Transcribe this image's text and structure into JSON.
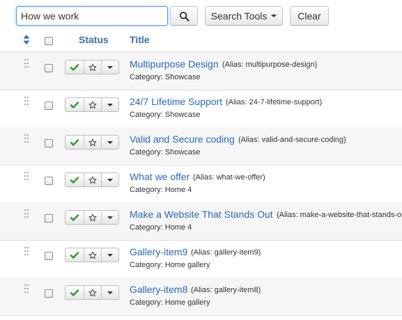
{
  "search": {
    "value": "How we work",
    "placeholder": ""
  },
  "toolbar": {
    "search_button_icon": "search-icon",
    "search_tools_label": "Search Tools",
    "clear_label": "Clear"
  },
  "table": {
    "headers": {
      "sort": "sort-icon",
      "status": "Status",
      "title": "Title"
    },
    "rows": [
      {
        "title": "Multipurpose Design",
        "alias": "(Alias: multipurpose-design)",
        "category": "Category: Showcase"
      },
      {
        "title": "24/7 Lifetime Support",
        "alias": "(Alias: 24-7-lifetime-support)",
        "category": "Category: Showcase"
      },
      {
        "title": "Valid and Secure coding",
        "alias": "(Alias: valid-and-secure-coding)",
        "category": "Category: Showcase"
      },
      {
        "title": "What we offer",
        "alias": "(Alias: what-we-offer)",
        "category": "Category: Home 4"
      },
      {
        "title": "Make a Website That Stands Out",
        "alias": "(Alias: make-a-website-that-stands-out)",
        "category": "Category: Home 4"
      },
      {
        "title": "Gallery-item9",
        "alias": "(Alias: gallery-item9)",
        "category": "Category: Home gallery"
      },
      {
        "title": "Gallery-item8",
        "alias": "(Alias: gallery-item8)",
        "category": "Category: Home gallery"
      }
    ]
  },
  "colors": {
    "link": "#2a69b8",
    "published_check": "#3a9a3a",
    "focus_border": "#4e95e1"
  }
}
